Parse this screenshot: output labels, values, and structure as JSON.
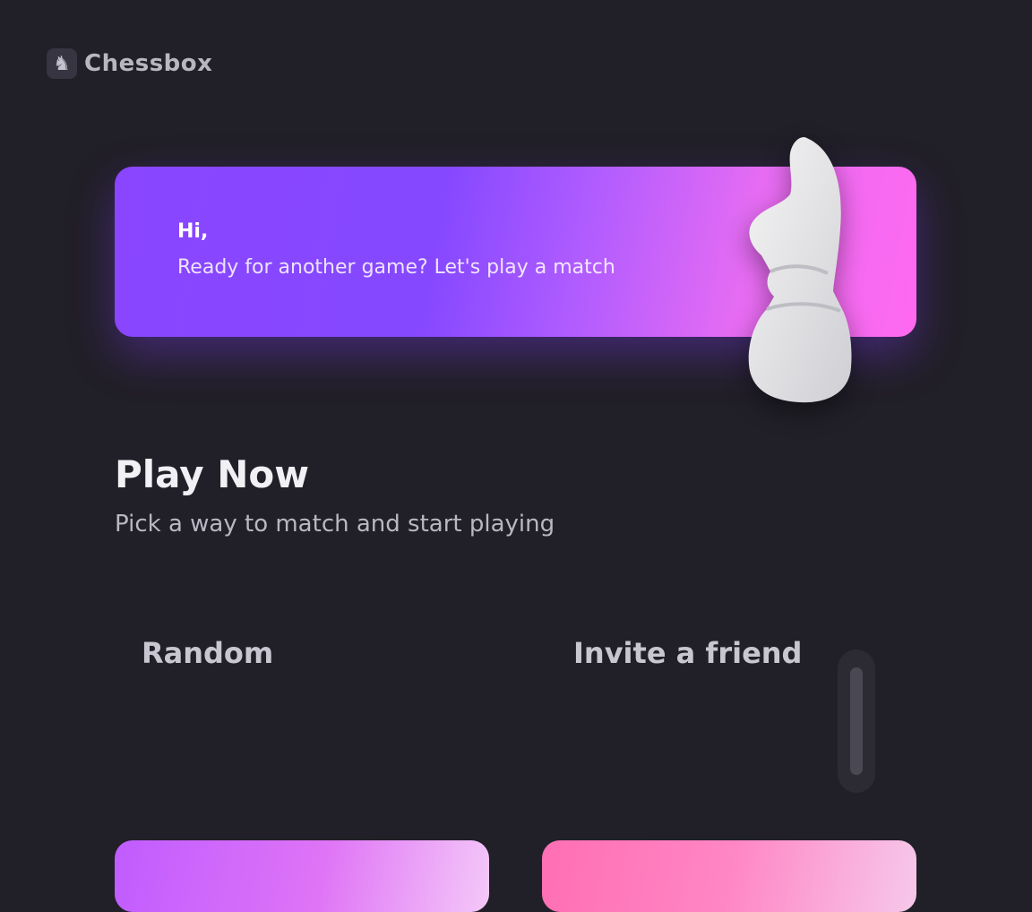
{
  "brand": {
    "name": "Chessbox",
    "icon": "chess-logo-icon"
  },
  "hero": {
    "tag": "Hi,",
    "subtitle": "Ready for another game? Let's play a match",
    "icon": "knight-piece-icon",
    "gradient_start": "#8a46ff",
    "gradient_end": "#ff69f0"
  },
  "play_now": {
    "title": "Play Now",
    "subtitle": "Pick a way to match and start playing"
  },
  "modes": [
    {
      "label": "Random",
      "description": ""
    },
    {
      "label": "Invite a friend",
      "description": ""
    }
  ],
  "colors": {
    "background": "#211f27",
    "card_primary": "#c05cff",
    "card_secondary": "#ff6fb3"
  }
}
